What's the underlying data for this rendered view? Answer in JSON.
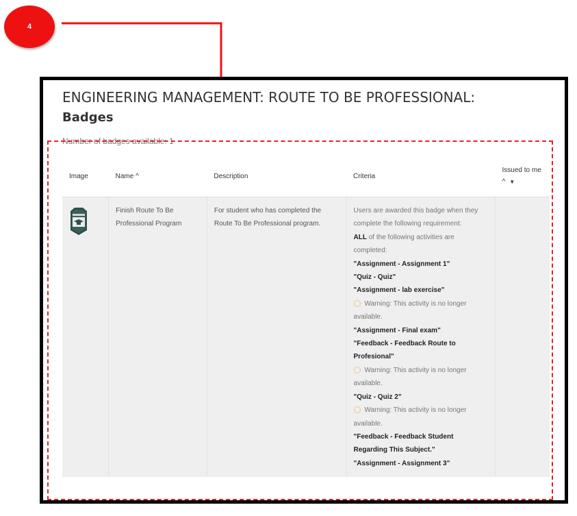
{
  "step": "4",
  "colors": {
    "accent_red": "#ee1111",
    "frame": "#000000"
  },
  "page": {
    "title": "ENGINEERING MANAGEMENT: ROUTE TO BE PROFESSIONAL:",
    "subtitle": "Badges",
    "badge_count": "Number of badges available: 1"
  },
  "table": {
    "headers": {
      "image": "Image",
      "name": "Name ^",
      "description": "Description",
      "criteria": "Criteria",
      "issued": "Issued to me ^",
      "issued_sort_icon": "sort-down-icon"
    },
    "row": {
      "image_icon": "badge-icon",
      "name": "Finish Route To Be Professional Program",
      "description": "For student who has completed the Route To Be Professional program.",
      "criteria": {
        "intro": "Users are awarded this badge when they complete the following requirement:",
        "all_prefix": "ALL",
        "all_suffix": " of the following activities are completed:",
        "activities": [
          {
            "text": "\"Assignment - Assignment 1\"",
            "warning": ""
          },
          {
            "text": "\"Quiz - Quiz\"",
            "warning": ""
          },
          {
            "text": "\"Assignment - lab exercise\"",
            "warning": "Warning: This activity is no longer available."
          },
          {
            "text": "\"Assignment - Final exam\"",
            "warning": ""
          },
          {
            "text": "\"Feedback - Feedback Route to Profesional\"",
            "warning": "Warning: This activity is no longer available."
          },
          {
            "text": "\"Quiz - Quiz 2\"",
            "warning": "Warning: This activity is no longer available."
          },
          {
            "text": "\"Feedback - Feedback Student Regarding This Subject.\"",
            "warning": ""
          },
          {
            "text": "\"Assignment - Assignment 3\"",
            "warning": ""
          }
        ]
      },
      "issued": ""
    }
  }
}
